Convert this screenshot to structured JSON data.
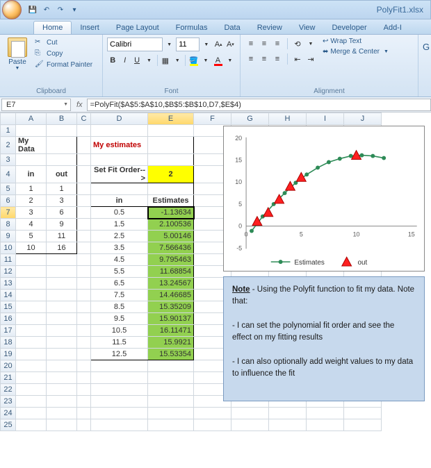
{
  "window": {
    "title": "PolyFit1.xlsx"
  },
  "tabs": [
    "Home",
    "Insert",
    "Page Layout",
    "Formulas",
    "Data",
    "Review",
    "View",
    "Developer",
    "Add-I"
  ],
  "active_tab": 0,
  "ribbon": {
    "clipboard": {
      "paste": "Paste",
      "cut": "Cut",
      "copy": "Copy",
      "format_painter": "Format Painter",
      "label": "Clipboard"
    },
    "font": {
      "name": "Calibri",
      "size": "11",
      "label": "Font"
    },
    "alignment": {
      "wrap": "Wrap Text",
      "merge": "Merge & Center",
      "label": "Alignment"
    }
  },
  "formula_bar": {
    "namebox": "E7",
    "formula": "=PolyFit($A$5:$A$10,$B$5:$B$10,D7,$E$4)"
  },
  "cell_text": {
    "my_data": "My Data",
    "my_estimates": "My estimates",
    "in": "in",
    "out": "out",
    "set_fit_order": "Set Fit Order-->",
    "estimates": "Estimates",
    "fit_order": "2"
  },
  "data_in_out": [
    {
      "in": "1",
      "out": "1"
    },
    {
      "in": "2",
      "out": "3"
    },
    {
      "in": "3",
      "out": "6"
    },
    {
      "in": "4",
      "out": "9"
    },
    {
      "in": "5",
      "out": "11"
    },
    {
      "in": "10",
      "out": "16"
    }
  ],
  "estimates": [
    {
      "in": "0.5",
      "est": "-1.13634"
    },
    {
      "in": "1.5",
      "est": "2.100536"
    },
    {
      "in": "2.5",
      "est": "5.00146"
    },
    {
      "in": "3.5",
      "est": "7.566436"
    },
    {
      "in": "4.5",
      "est": "9.795463"
    },
    {
      "in": "5.5",
      "est": "11.68854"
    },
    {
      "in": "6.5",
      "est": "13.24567"
    },
    {
      "in": "7.5",
      "est": "14.46685"
    },
    {
      "in": "8.5",
      "est": "15.35209"
    },
    {
      "in": "9.5",
      "est": "15.90137"
    },
    {
      "in": "10.5",
      "est": "16.11471"
    },
    {
      "in": "11.5",
      "est": "15.9921"
    },
    {
      "in": "12.5",
      "est": "15.53354"
    }
  ],
  "chart_data": {
    "type": "line+scatter",
    "title": "",
    "xlim": [
      0,
      15
    ],
    "ylim": [
      -5,
      20
    ],
    "xticks": [
      0,
      5,
      10,
      15
    ],
    "yticks": [
      -5,
      0,
      5,
      10,
      15,
      20
    ],
    "series": [
      {
        "name": "Estimates",
        "type": "line",
        "marker": "circle",
        "color": "#2e8b57",
        "x": [
          0.5,
          1.5,
          2.5,
          3.5,
          4.5,
          5.5,
          6.5,
          7.5,
          8.5,
          9.5,
          10.5,
          11.5,
          12.5
        ],
        "y": [
          -1.14,
          2.1,
          5.0,
          7.57,
          9.8,
          11.69,
          13.25,
          14.47,
          15.35,
          15.9,
          16.11,
          15.99,
          15.53
        ]
      },
      {
        "name": "out",
        "type": "scatter",
        "marker": "triangle",
        "color": "#ff0000",
        "x": [
          1,
          2,
          3,
          4,
          5,
          10
        ],
        "y": [
          1,
          3,
          6,
          9,
          11,
          16
        ]
      }
    ],
    "legend": {
      "items": [
        "Estimates",
        "out"
      ],
      "position": "bottom"
    }
  },
  "note": {
    "title": "Note",
    "intro": " - Using the Polyfit function to fit my data.  Note that:",
    "b1": "- I can set the polynomial fit order and see the effect on my fitting results",
    "b2": "- I can also optionally add weight values to my data to influence the fit"
  },
  "columns": [
    "",
    "A",
    "B",
    "C",
    "D",
    "E",
    "F",
    "G",
    "H",
    "I",
    "J"
  ]
}
